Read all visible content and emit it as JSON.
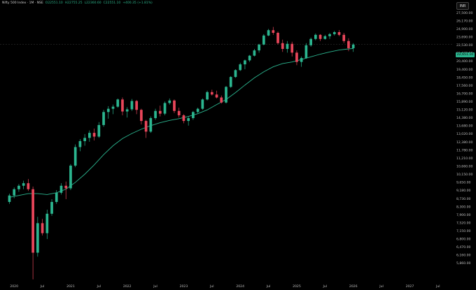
{
  "header": {
    "symbol": "Nifty 500 Index · 1M · NSE",
    "o": "O22551.10",
    "h": "H22755.25",
    "l": "L22360.60",
    "c": "C22551.10",
    "chg": "+400.35 (+1.81%)"
  },
  "currency_button": "INR",
  "last_price": "22,651.10",
  "chart_data": {
    "type": "candlestick",
    "title": "Nifty 500 Index · 1M · NSE",
    "y_scale": "log",
    "ylim": [
      5250,
      29000
    ],
    "y_ticks": [
      5860,
      6160,
      6470,
      6800,
      7150,
      7520,
      7900,
      8300,
      8730,
      9180,
      9650,
      10150,
      10660,
      11210,
      11780,
      12380,
      13020,
      13680,
      14380,
      15120,
      15890,
      16700,
      17560,
      18450,
      19400,
      20400,
      21440,
      22530,
      23690,
      24900,
      26170,
      27500
    ],
    "y_tick_labels": [
      "5,860.00",
      "6,160.00",
      "6,470.00",
      "6,800.00",
      "7,150.00",
      "7,520.00",
      "7,900.00",
      "8,300.00",
      "8,730.00",
      "9,180.00",
      "9,650.00",
      "10,150.00",
      "10,660.00",
      "11,210.00",
      "11,780.00",
      "12,380.00",
      "13,020.00",
      "13,680.00",
      "14,380.00",
      "15,120.00",
      "15,890.00",
      "16,700.00",
      "17,560.00",
      "18,450.00",
      "19,400.00",
      "20,400.00",
      "21,440.00",
      "22,530.00",
      "23,690.00",
      "24,900.00",
      "26,170.00",
      "27,500.00"
    ],
    "x_ticks": [
      {
        "label": "2020",
        "index": 1
      },
      {
        "label": "Jul",
        "index": 7
      },
      {
        "label": "2021",
        "index": 13
      },
      {
        "label": "Jul",
        "index": 19
      },
      {
        "label": "2022",
        "index": 25
      },
      {
        "label": "Jul",
        "index": 31
      },
      {
        "label": "2023",
        "index": 37
      },
      {
        "label": "Jul",
        "index": 43
      },
      {
        "label": "2024",
        "index": 49
      },
      {
        "label": "Jul",
        "index": 55
      },
      {
        "label": "2025",
        "index": 61
      },
      {
        "label": "Jul",
        "index": 67
      },
      {
        "label": "2026",
        "index": 73
      },
      {
        "label": "Jul",
        "index": 79
      },
      {
        "label": "2027",
        "index": 85
      },
      {
        "label": "Jul",
        "index": 91
      }
    ],
    "x_index_range": [
      -2,
      94
    ],
    "last_price": 22651.1,
    "up_color": "#2bb58f",
    "down_color": "#e8465a",
    "ma_color": "#2bb58f",
    "ohlc": [
      [
        8550,
        9000,
        8450,
        8900
      ],
      [
        8900,
        9350,
        8750,
        9250
      ],
      [
        9250,
        9550,
        9100,
        9450
      ],
      [
        9450,
        9750,
        9250,
        9600
      ],
      [
        9600,
        9850,
        9150,
        9250
      ],
      [
        9250,
        9400,
        5300,
        6250
      ],
      [
        6250,
        7800,
        6100,
        7500
      ],
      [
        7500,
        7700,
        6950,
        7050
      ],
      [
        7050,
        8150,
        6800,
        7950
      ],
      [
        7950,
        8700,
        7850,
        8550
      ],
      [
        8550,
        9200,
        8450,
        9050
      ],
      [
        9050,
        9600,
        8950,
        9450
      ],
      [
        9450,
        9700,
        8700,
        9300
      ],
      [
        9300,
        10800,
        9200,
        10700
      ],
      [
        10700,
        12200,
        10600,
        12000
      ],
      [
        12000,
        12600,
        11700,
        12450
      ],
      [
        12450,
        13000,
        12100,
        12700
      ],
      [
        12700,
        13300,
        12400,
        13100
      ],
      [
        13100,
        13450,
        12500,
        12800
      ],
      [
        12800,
        14000,
        12700,
        13750
      ],
      [
        13750,
        15100,
        13600,
        14900
      ],
      [
        14900,
        15450,
        14300,
        15200
      ],
      [
        15200,
        15600,
        14700,
        15400
      ],
      [
        15400,
        16200,
        15300,
        16100
      ],
      [
        16100,
        16300,
        14600,
        14950
      ],
      [
        14950,
        15350,
        14400,
        15150
      ],
      [
        15150,
        16150,
        15000,
        15950
      ],
      [
        15950,
        16050,
        14700,
        15100
      ],
      [
        15100,
        15200,
        13800,
        14100
      ],
      [
        14100,
        14200,
        12700,
        13200
      ],
      [
        13200,
        14500,
        13100,
        14350
      ],
      [
        14350,
        15200,
        14200,
        15000
      ],
      [
        15000,
        15500,
        14500,
        14750
      ],
      [
        14750,
        15900,
        14600,
        15750
      ],
      [
        15750,
        16200,
        15600,
        16000
      ],
      [
        16000,
        16100,
        14800,
        15000
      ],
      [
        15000,
        15300,
        14400,
        14600
      ],
      [
        14600,
        14700,
        13900,
        14100
      ],
      [
        14100,
        14500,
        13700,
        14350
      ],
      [
        14350,
        15000,
        14200,
        14900
      ],
      [
        14900,
        15300,
        14800,
        15200
      ],
      [
        15200,
        16200,
        15100,
        16100
      ],
      [
        16100,
        17000,
        16000,
        16850
      ],
      [
        16850,
        17100,
        16500,
        16600
      ],
      [
        16600,
        17000,
        16200,
        16300
      ],
      [
        16300,
        16500,
        15700,
        15800
      ],
      [
        15800,
        17500,
        15700,
        17400
      ],
      [
        17400,
        18600,
        17300,
        18500
      ],
      [
        18500,
        19400,
        18400,
        19300
      ],
      [
        19300,
        20200,
        19200,
        20000
      ],
      [
        20000,
        20600,
        19400,
        20500
      ],
      [
        20500,
        21200,
        20300,
        21100
      ],
      [
        21100,
        22000,
        21000,
        21800
      ],
      [
        21800,
        22700,
        21500,
        22600
      ],
      [
        22600,
        24100,
        22500,
        23900
      ],
      [
        23900,
        24900,
        23800,
        24700
      ],
      [
        24700,
        25200,
        24000,
        24300
      ],
      [
        24300,
        24500,
        22600,
        22800
      ],
      [
        22800,
        23300,
        21600,
        22000
      ],
      [
        22000,
        23100,
        21500,
        22700
      ],
      [
        22700,
        23000,
        21000,
        21500
      ],
      [
        21500,
        21800,
        19900,
        20300
      ],
      [
        20300,
        21000,
        19700,
        20800
      ],
      [
        20800,
        22800,
        20700,
        22500
      ],
      [
        22500,
        23600,
        22300,
        23400
      ],
      [
        23400,
        24200,
        23200,
        24000
      ],
      [
        24000,
        24100,
        23100,
        23400
      ],
      [
        23400,
        24000,
        23300,
        23800
      ],
      [
        23800,
        24300,
        23400,
        24100
      ],
      [
        24100,
        24600,
        23900,
        24400
      ],
      [
        24400,
        24700,
        23800,
        24000
      ],
      [
        24000,
        24300,
        22800,
        23100
      ],
      [
        23100,
        23500,
        21700,
        22100
      ],
      [
        22100,
        22800,
        21600,
        22600
      ]
    ],
    "ma": [
      [
        0,
        8800
      ],
      [
        2,
        8900
      ],
      [
        4,
        9000
      ],
      [
        6,
        9000
      ],
      [
        8,
        8950
      ],
      [
        10,
        9050
      ],
      [
        12,
        9250
      ],
      [
        14,
        9650
      ],
      [
        16,
        10150
      ],
      [
        18,
        10750
      ],
      [
        20,
        11450
      ],
      [
        22,
        12100
      ],
      [
        24,
        12650
      ],
      [
        26,
        13050
      ],
      [
        28,
        13400
      ],
      [
        30,
        13700
      ],
      [
        32,
        13950
      ],
      [
        34,
        14150
      ],
      [
        36,
        14300
      ],
      [
        38,
        14500
      ],
      [
        40,
        14750
      ],
      [
        42,
        15100
      ],
      [
        44,
        15600
      ],
      [
        46,
        16100
      ],
      [
        48,
        16800
      ],
      [
        50,
        17600
      ],
      [
        52,
        18400
      ],
      [
        54,
        19100
      ],
      [
        56,
        19700
      ],
      [
        58,
        20100
      ],
      [
        60,
        20300
      ],
      [
        62,
        20600
      ],
      [
        64,
        20950
      ],
      [
        66,
        21300
      ],
      [
        68,
        21600
      ],
      [
        70,
        21850
      ],
      [
        72,
        22000
      ],
      [
        73,
        22050
      ]
    ]
  }
}
